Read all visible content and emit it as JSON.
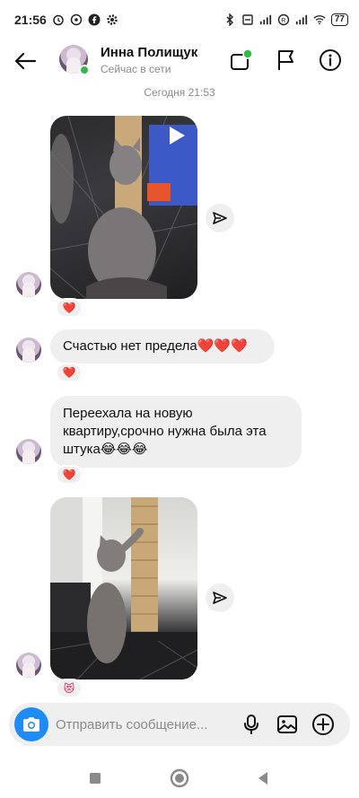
{
  "status_bar": {
    "time": "21:56",
    "battery": "77",
    "left_icons": [
      "alarm-icon",
      "viber-icon",
      "facebook-icon",
      "settings-icon"
    ],
    "right_icons": [
      "bluetooth-icon",
      "vibrate-icon",
      "signal-icon",
      "data-saver-icon",
      "signal-icon",
      "wifi-icon"
    ]
  },
  "header": {
    "name": "Инна Полищук",
    "status": "Сейчас в сети",
    "online_color": "#2fbb4a",
    "actions": [
      "video-call-icon",
      "flag-icon",
      "info-icon"
    ]
  },
  "date_separator": "Сегодня 21:53",
  "messages": [
    {
      "type": "photo",
      "content": "кот у когтеточки",
      "is_video": true,
      "reaction": "❤️"
    },
    {
      "type": "text",
      "text": "Счастью нет предела❤️❤️❤️",
      "reaction": "❤️"
    },
    {
      "type": "text",
      "text": "Переехала на новую квартиру,срочно нужна была эта штука😂😂😂",
      "reaction": "❤️"
    },
    {
      "type": "photo",
      "content": "кот точит когти о когтеточку",
      "is_video": false,
      "reaction": "😻"
    }
  ],
  "composer": {
    "placeholder": "Отправить сообщение...",
    "accent": "#1d8cf8"
  },
  "navbar": [
    "recents-button",
    "home-button",
    "back-button"
  ]
}
